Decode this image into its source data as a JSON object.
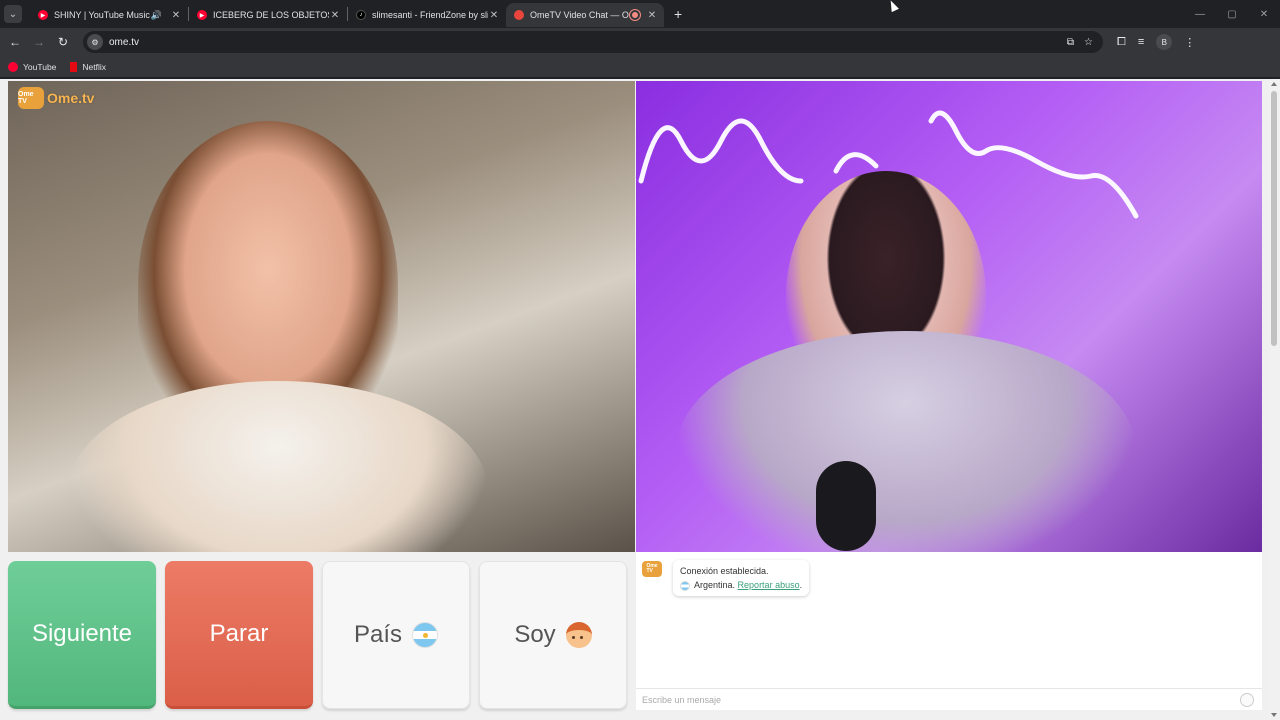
{
  "browser": {
    "tabs": [
      {
        "title": "SHINY | YouTube Music",
        "favicon": "youtube-music-icon",
        "audio": true
      },
      {
        "title": "ICEBERG DE LOS OBJETOS PERD",
        "favicon": "youtube-icon"
      },
      {
        "title": "slimesanti - FriendZone by slim",
        "favicon": "tiktok-icon"
      },
      {
        "title": "OmeTV Video Chat — Ome",
        "favicon": "ometv-icon",
        "active": true,
        "recording": true
      }
    ],
    "new_tab_label": "+",
    "url": "ome.tv",
    "profile_initial": "B",
    "bookmarks": [
      {
        "label": "YouTube",
        "icon": "youtube-icon"
      },
      {
        "label": "Netflix",
        "icon": "netflix-icon"
      }
    ]
  },
  "ometv": {
    "logo_badge": "Ome TV",
    "logo_text": "Ome.tv",
    "buttons": {
      "next": "Siguiente",
      "stop": "Parar",
      "country": "País",
      "gender": "Soy"
    },
    "colors": {
      "next": "#5cc288",
      "stop": "#e46a52"
    },
    "chat": {
      "message_line1": "Conexión establecida.",
      "country_name": "Argentina.",
      "report_link": "Reportar abuso",
      "report_suffix": ".",
      "input_placeholder": "Escribe un mensaje"
    }
  }
}
